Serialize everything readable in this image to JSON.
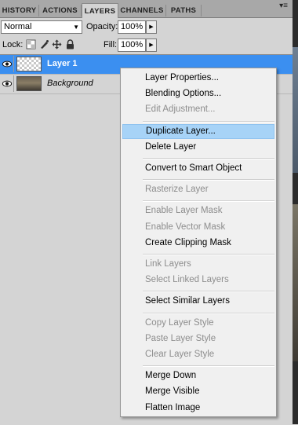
{
  "tabs": [
    {
      "label": "HISTORY",
      "active": false
    },
    {
      "label": "ACTIONS",
      "active": false
    },
    {
      "label": "LAYERS",
      "active": true
    },
    {
      "label": "CHANNELS",
      "active": false
    },
    {
      "label": "PATHS",
      "active": false
    }
  ],
  "panel_menu_icon": "▾≡",
  "blend_mode": {
    "value": "Normal"
  },
  "opacity": {
    "label": "Opacity:",
    "value": "100%"
  },
  "lock": {
    "label": "Lock:"
  },
  "fill": {
    "label": "Fill:",
    "value": "100%"
  },
  "layers": [
    {
      "name": "Layer 1",
      "selected": true,
      "thumbnail": "transparent"
    },
    {
      "name": "Background",
      "selected": false,
      "thumbnail": "photo"
    }
  ],
  "context_menu": {
    "items": [
      {
        "label": "Layer Properties...",
        "enabled": true
      },
      {
        "label": "Blending Options...",
        "enabled": true
      },
      {
        "label": "Edit Adjustment...",
        "enabled": false
      },
      {
        "separator": true
      },
      {
        "label": "Duplicate Layer...",
        "enabled": true,
        "highlighted": true
      },
      {
        "label": "Delete Layer",
        "enabled": true
      },
      {
        "separator": true
      },
      {
        "label": "Convert to Smart Object",
        "enabled": true
      },
      {
        "separator": true
      },
      {
        "label": "Rasterize Layer",
        "enabled": false
      },
      {
        "separator": true
      },
      {
        "label": "Enable Layer Mask",
        "enabled": false
      },
      {
        "label": "Enable Vector Mask",
        "enabled": false
      },
      {
        "label": "Create Clipping Mask",
        "enabled": true
      },
      {
        "separator": true
      },
      {
        "label": "Link Layers",
        "enabled": false
      },
      {
        "label": "Select Linked Layers",
        "enabled": false
      },
      {
        "separator": true
      },
      {
        "label": "Select Similar Layers",
        "enabled": true
      },
      {
        "separator": true
      },
      {
        "label": "Copy Layer Style",
        "enabled": false
      },
      {
        "label": "Paste Layer Style",
        "enabled": false
      },
      {
        "label": "Clear Layer Style",
        "enabled": false
      },
      {
        "separator": true
      },
      {
        "label": "Merge Down",
        "enabled": true
      },
      {
        "label": "Merge Visible",
        "enabled": true
      },
      {
        "label": "Flatten Image",
        "enabled": true
      }
    ]
  },
  "colors": {
    "selection": "#3b8ff0",
    "menu_highlight": "#a7d3f7",
    "panel_bg": "#d4d4d4"
  }
}
